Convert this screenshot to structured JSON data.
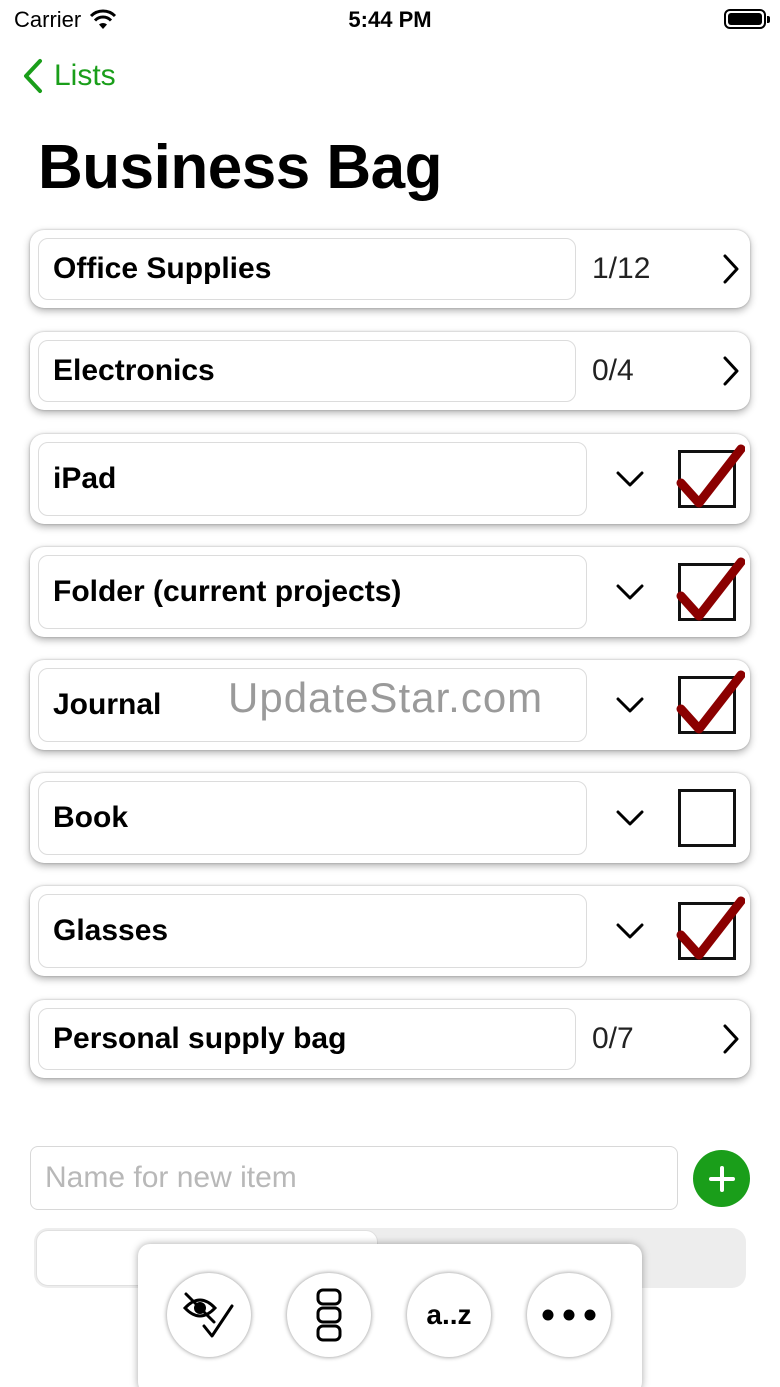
{
  "status_bar": {
    "carrier": "Carrier",
    "time": "5:44 PM"
  },
  "nav": {
    "back_label": "Lists"
  },
  "page": {
    "title": "Business Bag"
  },
  "rows": [
    {
      "type": "group",
      "name": "Office Supplies",
      "count": "1/12"
    },
    {
      "type": "group",
      "name": "Electronics",
      "count": "0/4"
    },
    {
      "type": "item",
      "name": "iPad",
      "checked": true
    },
    {
      "type": "item",
      "name": "Folder (current projects)",
      "checked": true
    },
    {
      "type": "item",
      "name": "Journal",
      "checked": true
    },
    {
      "type": "item",
      "name": "Book",
      "checked": false
    },
    {
      "type": "item",
      "name": "Glasses",
      "checked": true
    },
    {
      "type": "group",
      "name": "Personal supply bag",
      "count": "0/7"
    }
  ],
  "watermark": "UpdateStar.com",
  "new_item": {
    "placeholder": "Name for new item",
    "value": ""
  },
  "progress": {
    "fraction": 0.48
  },
  "toolbar": {
    "buttons": [
      {
        "name": "hide-checked-button",
        "icon": "eye-slash-check-icon"
      },
      {
        "name": "group-view-button",
        "icon": "stacked-blocks-icon"
      },
      {
        "name": "sort-button",
        "label": "a..z"
      },
      {
        "name": "more-button",
        "icon": "ellipsis-icon"
      }
    ]
  },
  "colors": {
    "accent": "#1a9e1a",
    "check": "#8b0000"
  }
}
